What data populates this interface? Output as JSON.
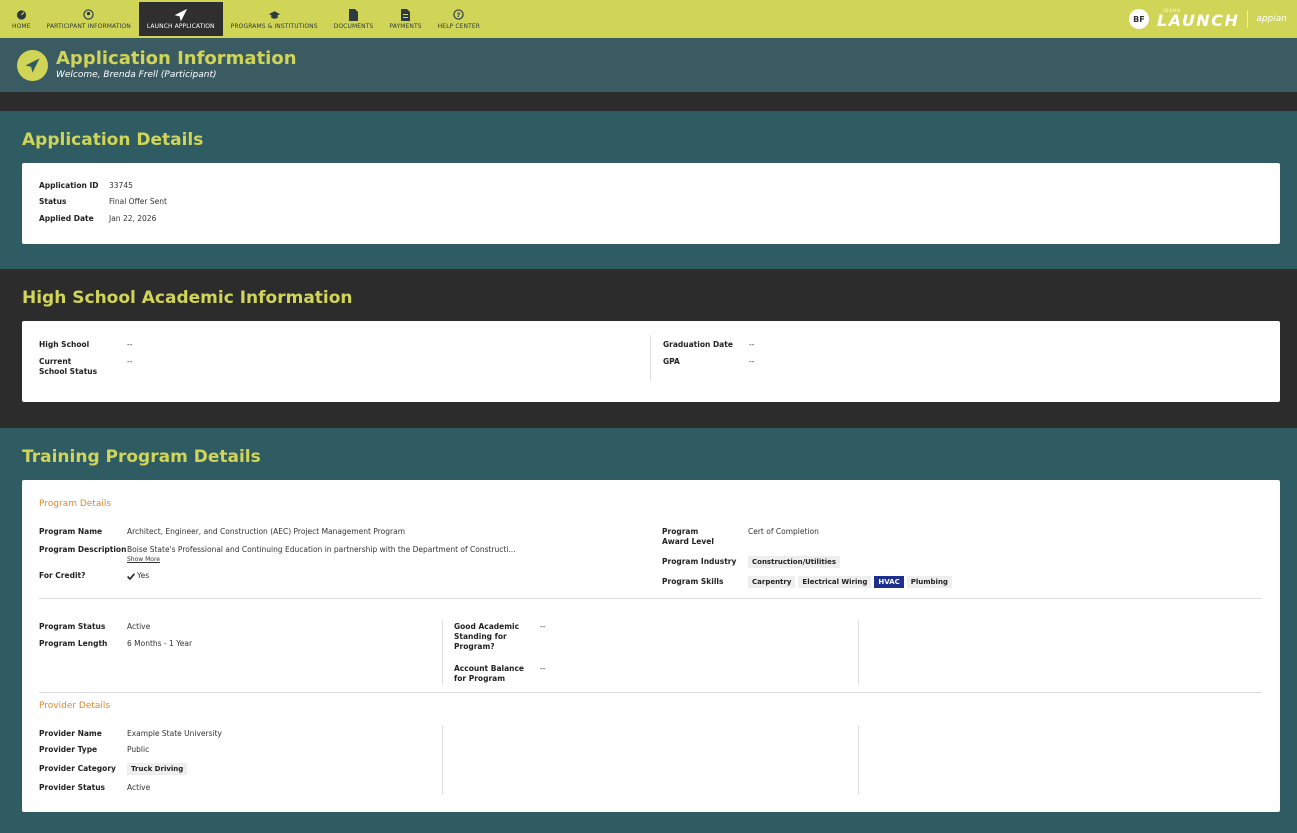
{
  "nav": {
    "items": [
      {
        "label": "HOME",
        "icon": "dashboard-icon"
      },
      {
        "label": "PARTICIPANT INFORMATION",
        "icon": "user-circle-icon"
      },
      {
        "label": "LAUNCH APPLICATION",
        "icon": "paper-plane-icon",
        "active": true
      },
      {
        "label": "PROGRAMS & INSTITUTIONS",
        "icon": "graduation-cap-icon"
      },
      {
        "label": "DOCUMENTS",
        "icon": "document-icon"
      },
      {
        "label": "PAYMENTS",
        "icon": "invoice-icon"
      },
      {
        "label": "HELP CENTER",
        "icon": "question-circle-icon"
      }
    ],
    "avatar_initials": "BF",
    "brand_small": "IDAHO",
    "brand_main": "LAUNCH",
    "appian": "appian"
  },
  "banner": {
    "title": "Application Information",
    "subtitle": "Welcome, Brenda Frell (Participant)"
  },
  "application_details": {
    "title": "Application Details",
    "id_label": "Application ID",
    "id_value": "33745",
    "status_label": "Status",
    "status_value": "Final Offer Sent",
    "applied_label": "Applied Date",
    "applied_value": "Jan 22, 2026"
  },
  "high_school": {
    "title": "High School Academic Information",
    "school_label": "High School",
    "school_value": "--",
    "current_label": "Current School Status",
    "current_value": "--",
    "grad_label": "Graduation Date",
    "grad_value": "--",
    "gpa_label": "GPA",
    "gpa_value": "--"
  },
  "training": {
    "title": "Training Program Details",
    "program_details_head": "Program Details",
    "name_label": "Program Name",
    "name_value": "Architect, Engineer, and Construction (AEC) Project Management Program",
    "desc_label": "Program Description",
    "desc_value": "Boise State's Professional and Continuing Education in partnership with the Department of Constructi...",
    "show_more": "Show More",
    "credit_label": "For Credit?",
    "credit_value": "Yes",
    "award_label": "Program Award Level",
    "award_value": "Cert of Completion",
    "industry_label": "Program Industry",
    "industry_value": "Construction/Utilities",
    "skills_label": "Program Skills",
    "skills": [
      {
        "label": "Carpentry",
        "selected": false
      },
      {
        "label": "Electrical Wiring",
        "selected": false
      },
      {
        "label": "HVAC",
        "selected": true
      },
      {
        "label": "Plumbing",
        "selected": false
      }
    ],
    "status_label": "Program Status",
    "status_value": "Active",
    "length_label": "Program Length",
    "length_value": "6 Months - 1 Year",
    "standing_label": "Good Academic Standing for Program?",
    "standing_value": "--",
    "balance_label": "Account Balance for Program",
    "balance_value": "--",
    "provider_head": "Provider Details",
    "provider_name_label": "Provider Name",
    "provider_name_value": "Example State University",
    "provider_type_label": "Provider Type",
    "provider_type_value": "Public",
    "provider_cat_label": "Provider Category",
    "provider_cat_value": "Truck Driving",
    "provider_status_label": "Provider Status",
    "provider_status_value": "Active"
  },
  "colors": {
    "accent": "#d1d557",
    "teal": "#2f5b62",
    "banner": "#3b5b63",
    "dark": "#2c2c2c",
    "orange": "#e08a2a",
    "selected_chip": "#1c2f8e"
  }
}
